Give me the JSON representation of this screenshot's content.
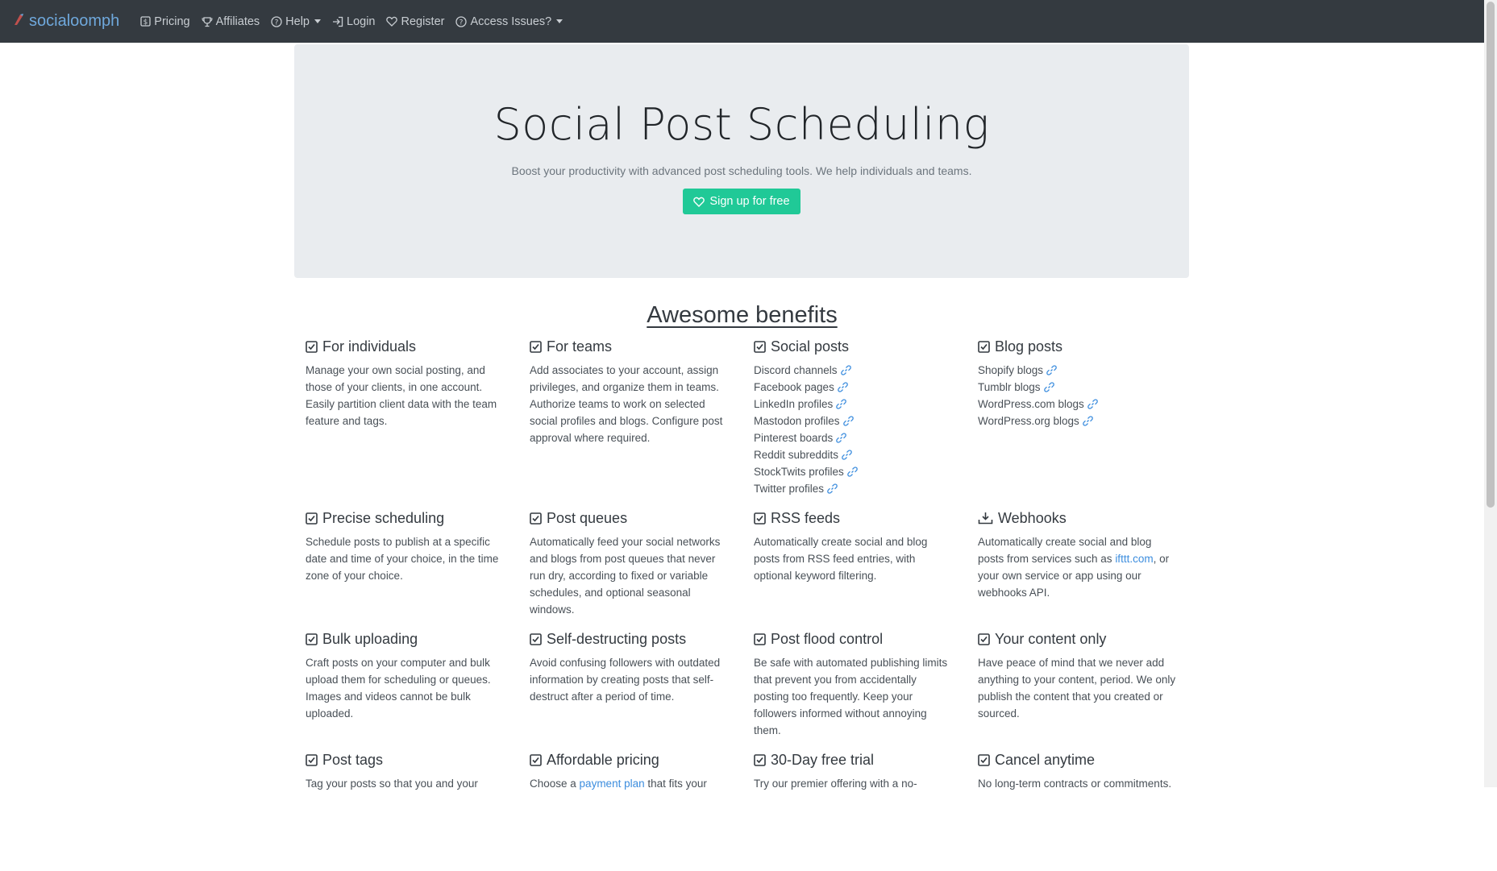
{
  "navbar": {
    "brand": "socialoomph",
    "items": [
      {
        "label": "Pricing",
        "icon": "dollar-box-icon"
      },
      {
        "label": "Affiliates",
        "icon": "trophy-icon"
      },
      {
        "label": "Help",
        "icon": "question-circle-icon",
        "dropdown": true
      },
      {
        "label": "Login",
        "icon": "login-arrow-icon"
      },
      {
        "label": "Register",
        "icon": "heart-icon"
      },
      {
        "label": "Access Issues?",
        "icon": "question-circle-icon",
        "dropdown": true
      }
    ]
  },
  "hero": {
    "title": "Social Post Scheduling",
    "subtitle": "Boost your productivity with advanced post scheduling tools. We help individuals and teams.",
    "cta": "Sign up for free"
  },
  "benefits": {
    "title": "Awesome benefits",
    "row1": [
      {
        "title": "For individuals",
        "desc": "Manage your own social posting, and those of your clients, in one account. Easily partition client data with the team feature and tags."
      },
      {
        "title": "For teams",
        "desc": "Add associates to your account, assign privileges, and organize them in teams. Authorize teams to work on selected social profiles and blogs. Configure post approval where required."
      },
      {
        "title": "Social posts",
        "items": [
          "Discord channels",
          "Facebook pages",
          "LinkedIn profiles",
          "Mastodon profiles",
          "Pinterest boards",
          "Reddit subreddits",
          "StockTwits profiles",
          "Twitter profiles"
        ]
      },
      {
        "title": "Blog posts",
        "items": [
          "Shopify blogs",
          "Tumblr blogs",
          "WordPress.com blogs",
          "WordPress.org blogs"
        ]
      }
    ],
    "row2": [
      {
        "title": "Precise scheduling",
        "desc": "Schedule posts to publish at a specific date and time of your choice, in the time zone of your choice."
      },
      {
        "title": "Post queues",
        "desc": "Automatically feed your social networks and blogs from post queues that never run dry, according to fixed or variable schedules, and optional seasonal windows."
      },
      {
        "title": "RSS feeds",
        "desc": "Automatically create social and blog posts from RSS feed entries, with optional keyword filtering."
      },
      {
        "title": "Webhooks",
        "desc_a": "Automatically create social and blog posts from services such as ",
        "desc_link": "ifttt.com",
        "desc_b": ", or your own service or app using our webhooks API."
      }
    ],
    "row3": [
      {
        "title": "Bulk uploading",
        "desc": "Craft posts on your computer and bulk upload them for scheduling or queues. Images and videos cannot be bulk uploaded."
      },
      {
        "title": "Self-destructing posts",
        "desc": "Avoid confusing followers with outdated information by creating posts that self-destruct after a period of time."
      },
      {
        "title": "Post flood control",
        "desc": "Be safe with automated publishing limits that prevent you from accidentally posting too frequently. Keep your followers informed without annoying them."
      },
      {
        "title": "Your content only",
        "desc": "Have peace of mind that we never add anything to your content, period. We only publish the content that you created or sourced."
      }
    ],
    "row4": [
      {
        "title": "Post tags",
        "desc": "Tag your posts so that you and your"
      },
      {
        "title": "Affordable pricing",
        "desc_a": "Choose a ",
        "desc_link": "payment plan",
        "desc_b": " that fits your"
      },
      {
        "title": "30-Day free trial",
        "desc": "Try our premier offering with a no-"
      },
      {
        "title": "Cancel anytime",
        "desc": "No long-term contracts or commitments."
      }
    ]
  },
  "colors": {
    "navbar": "#343a40",
    "brand": "#6fa8dc",
    "cta": "#20c997",
    "hero_bg": "#e9ecef",
    "link": "#3c8dde"
  }
}
